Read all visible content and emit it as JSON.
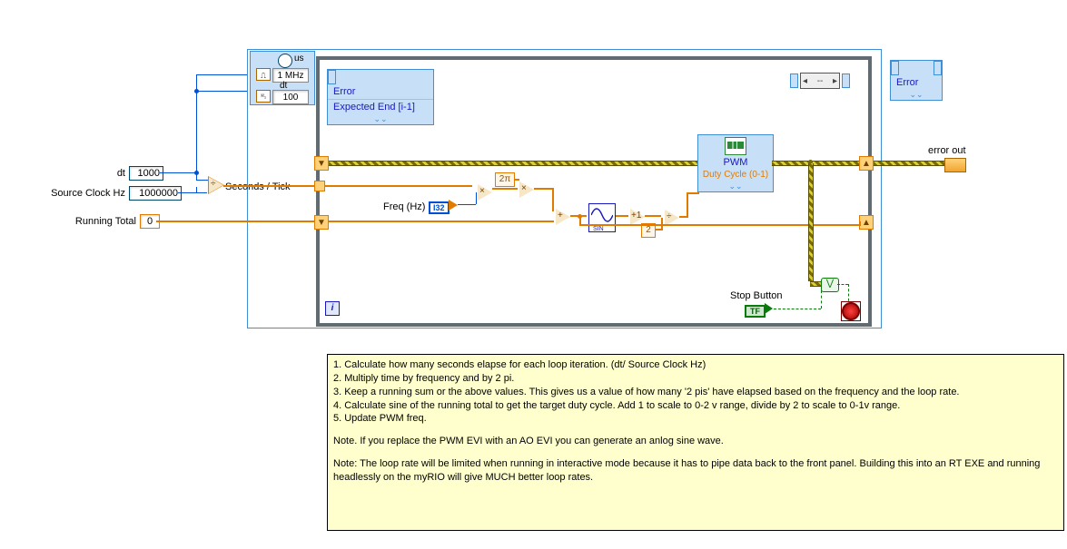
{
  "timed_loop": {
    "unit_label": "us",
    "clock_value": "1 MHz",
    "dt_label": "dt",
    "dt_value": "100"
  },
  "left_node": {
    "row1": "Error",
    "row2": "Expected End [i-1]"
  },
  "right_inner_node": {
    "selector_value": "--"
  },
  "right_outer_node": {
    "label": "Error"
  },
  "controls": {
    "dt_label": "dt",
    "dt_value": "1000",
    "src_label": "Source Clock Hz",
    "src_value": "1000000",
    "running_label": "Running Total",
    "running_value": "0"
  },
  "labels": {
    "seconds_per_tick": "Seconds / Tick",
    "freq": "Freq (Hz)",
    "two_pi": "2π",
    "two": "2",
    "stop": "Stop Button",
    "error_out": "error out"
  },
  "evi": {
    "name": "PWM",
    "terminal": "Duty Cycle (0-1)"
  },
  "notes": {
    "l1": "1. Calculate how many seconds elapse for each loop iteration.  (dt/ Source Clock Hz)",
    "l2": "2. Multiply time by frequency and by 2 pi.",
    "l3": "3. Keep a running sum or the above values.  This gives us a value of how many '2 pis' have elapsed based on the frequency and the loop rate.",
    "l4": "4. Calculate sine of the running total to get the target duty cycle.  Add 1 to scale to 0-2 v range, divide by 2 to scale to 0-1v range.",
    "l5": "5. Update PWM freq.",
    "n1": "Note.  If you replace the PWM EVI with an AO EVI you can generate an anlog sine wave.",
    "n2": "Note: The loop rate will be limited when running in interactive mode because it has to pipe data back to the front panel.  Building this into an RT EXE and running headlessly on the myRIO will give MUCH better loop rates."
  }
}
